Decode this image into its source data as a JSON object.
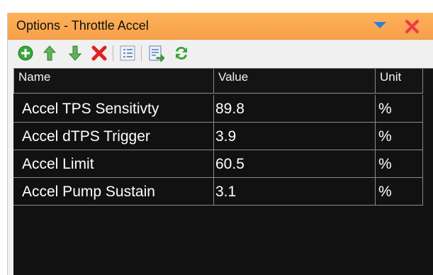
{
  "window": {
    "title": "Options - Throttle Accel"
  },
  "toolbar": {
    "buttons": [
      {
        "icon": "add-icon"
      },
      {
        "icon": "move-up-icon"
      },
      {
        "icon": "move-down-icon"
      },
      {
        "icon": "delete-icon"
      },
      {
        "icon": "list-edit-icon"
      },
      {
        "icon": "import-icon"
      },
      {
        "icon": "refresh-icon"
      }
    ]
  },
  "table": {
    "columns": [
      "Name",
      "Value",
      "Unit"
    ],
    "rows": [
      {
        "name": "Accel TPS Sensitivty",
        "value": "89.8",
        "unit": "%"
      },
      {
        "name": "Accel dTPS Trigger",
        "value": "3.9",
        "unit": "%"
      },
      {
        "name": "Accel Limit",
        "value": "60.5",
        "unit": "%"
      },
      {
        "name": "Accel Pump Sustain",
        "value": "3.1",
        "unit": "%"
      }
    ]
  },
  "colors": {
    "titlebar": "#f7a04a",
    "grid_background": "#111111",
    "grid_text": "#ffffff",
    "add": "#3aa53a",
    "delete": "#e02020"
  }
}
